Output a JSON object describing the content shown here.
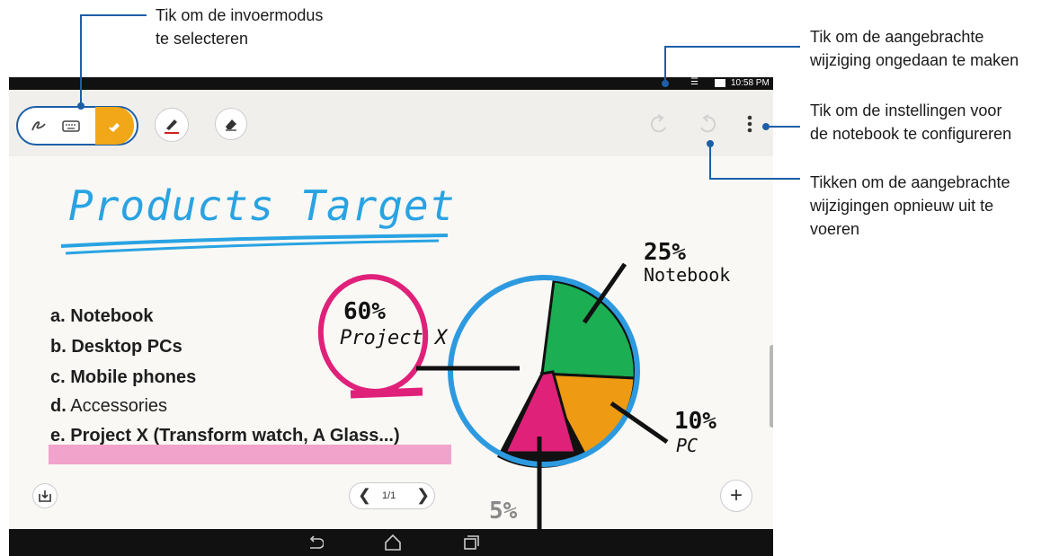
{
  "callouts": {
    "input_mode": "Tik om de invoermodus\nte selecteren",
    "undo": "Tik om de aangebrachte\nwijziging ongedaan te maken",
    "settings": "Tik om de instellingen voor\nde notebook te configureren",
    "redo": "Tikken om de aangebrachte\nwijzigingen opnieuw uit te\nvoeren"
  },
  "status": {
    "time": "10:58 PM"
  },
  "note": {
    "title": "Products Target",
    "list": [
      {
        "letter": "a.",
        "text": "Notebook",
        "bold": true
      },
      {
        "letter": "b.",
        "text": "Desktop PCs",
        "bold": true
      },
      {
        "letter": "c.",
        "text": "Mobile phones",
        "bold": true
      },
      {
        "letter": "d.",
        "text": "Accessories",
        "bold": false
      },
      {
        "letter": "e.",
        "text": "Project X (Transform watch, A Glass...)",
        "bold": true
      }
    ],
    "annotations": {
      "project_pct": "60%",
      "project_label": "Project X",
      "notebook_pct": "25%",
      "notebook_label": "Notebook",
      "pc_pct": "10%",
      "pc_label": "PC",
      "small_pct": "5%"
    }
  },
  "pager": {
    "page": "1/1"
  },
  "colors": {
    "accent_blue": "#1c5fa8",
    "highlight_yellow": "#f2a719",
    "pie_green": "#1cae52",
    "pie_orange": "#ee9a12",
    "pie_pink": "#e0217a",
    "pie_outline": "#2d9ae0",
    "title_blue": "#29a3e2"
  },
  "chart_data": {
    "type": "pie",
    "slices": [
      {
        "label": "Notebook",
        "value": 25
      },
      {
        "label": "PC",
        "value": 10
      },
      {
        "label": "",
        "value": 5
      },
      {
        "label": "Project X",
        "value": 60
      }
    ]
  },
  "icons": [
    "pen-mode-icon",
    "keyboard-icon",
    "highlighter-mode-icon",
    "brush-icon",
    "eraser-icon",
    "undo-icon",
    "redo-icon",
    "more-vert-icon",
    "import-icon",
    "chevron-left-icon",
    "chevron-right-icon",
    "add-icon",
    "back-icon",
    "home-icon",
    "recents-icon",
    "wifi-icon",
    "battery-icon"
  ]
}
